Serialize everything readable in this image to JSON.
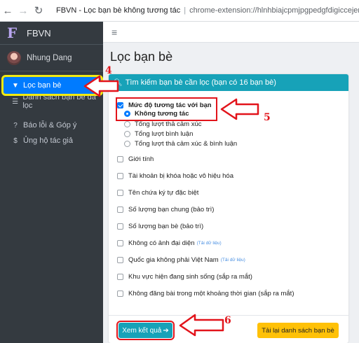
{
  "browser": {
    "back_icon": "back-arrow-icon",
    "forward_icon": "forward-arrow-icon",
    "reload_icon": "reload-icon",
    "tab_title": "FBVN - Lọc bạn bè không tương tác",
    "separator": "|",
    "url": "chrome-extension://hlnhbiajcpmjpgpedgfdigiccejen"
  },
  "sidebar": {
    "logo": "F",
    "brand": "FBVN",
    "user_name": "Nhung Dang",
    "items": [
      {
        "icon": "filter-icon",
        "label": "Lọc bạn bè",
        "active": true
      },
      {
        "icon": "list-icon",
        "label": "Danh sách bạn bè đã lọc"
      },
      {
        "icon": "help-circle-icon",
        "label": "Báo lỗi & Góp ý"
      },
      {
        "icon": "donate-icon",
        "label": "Ủng hộ tác giả"
      }
    ]
  },
  "main": {
    "menu_icon": "≡",
    "page_title": "Lọc bạn bè",
    "card_header": "Tìm kiếm bạn bè cần lọc (bạn có 16 bạn bè)",
    "interaction": {
      "label": "Mức độ tương tác với bạn",
      "checked": true,
      "options": [
        {
          "label": "Không tương tác",
          "selected": true
        },
        {
          "label": "Tổng lượt thả cảm xúc"
        },
        {
          "label": "Tổng lượt bình luận"
        },
        {
          "label": "Tổng lượt thả cảm xúc & bình luận"
        }
      ]
    },
    "filters": [
      {
        "label": "Giới tính"
      },
      {
        "label": "Tài khoản bị khóa hoặc vô hiệu hóa"
      },
      {
        "label": "Tên chứa ký tự đặc biệt"
      },
      {
        "label": "Số lượng bạn chung (bảo trì)"
      },
      {
        "label": "Số lượng bạn bè (bảo trì)"
      },
      {
        "label": "Không có ảnh đại diện",
        "hint": "(Tải dữ liệu)"
      },
      {
        "label": "Quốc gia không phải Việt Nam",
        "hint": "(Tải dữ liệu)"
      },
      {
        "label": "Khu vực hiện đang sinh sống (sắp ra mắt)"
      },
      {
        "label": "Không đăng bài trong một khoảng thời gian (sắp ra mắt)"
      }
    ],
    "view_button": "Xem kết quả",
    "reload_button": "Tải lại danh sách bạn bè"
  },
  "annotations": {
    "n4": "4",
    "n5": "5",
    "n6": "6"
  },
  "colors": {
    "accent": "#17a2b8",
    "active": "#007bff",
    "highlight": "#e2141b",
    "yellow": "#ffc107"
  }
}
